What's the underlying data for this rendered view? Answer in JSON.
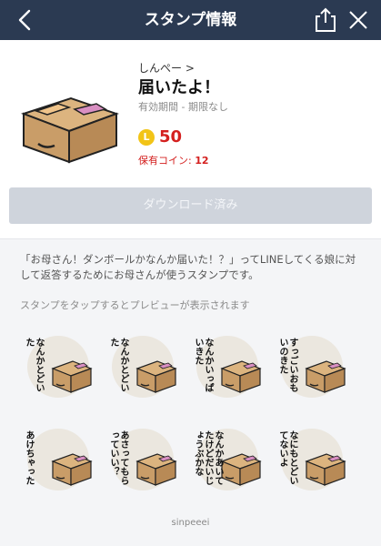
{
  "header": {
    "title": "スタンプ情報",
    "back_icon": "chevron-left-icon",
    "share_icon": "share-icon",
    "close_icon": "close-icon"
  },
  "sticker_pack": {
    "author": "しんぺー >",
    "name": "届いたよ！",
    "validity": "有効期間 - 期限なし",
    "price": "50",
    "coin_badge": "L",
    "held_label": "保有コイン: ",
    "held_value": "12",
    "download_label": "ダウンロード済み"
  },
  "description": "「お母さん！ダンボールかなんか届いた！？」ってLINEしてくる娘に対して返答するためにお母さんが使うスタンプです。",
  "hint": "スタンプをタップするとプレビューが表示されます",
  "stickers": [
    {
      "text": "なんかとどいた"
    },
    {
      "text": "なんかとどいた"
    },
    {
      "text": "なんかいっぱいきた"
    },
    {
      "text": "すっごいおもいのきた"
    },
    {
      "text": "あけちゃった"
    },
    {
      "text": "あさってもらっていい？"
    },
    {
      "text": "なんかあいてたけどだいじょうぶかな"
    },
    {
      "text": "なにもとどいてないよ"
    }
  ],
  "footer": "sinpeeei",
  "colors": {
    "header_bg": "#2b3a52",
    "price_red": "#d4201f",
    "coin_yellow": "#f2c417",
    "button_disabled": "#cfd4dc",
    "box": "#c99d68",
    "box_dark": "#a97d4c",
    "label_pink": "#d98fc2"
  }
}
